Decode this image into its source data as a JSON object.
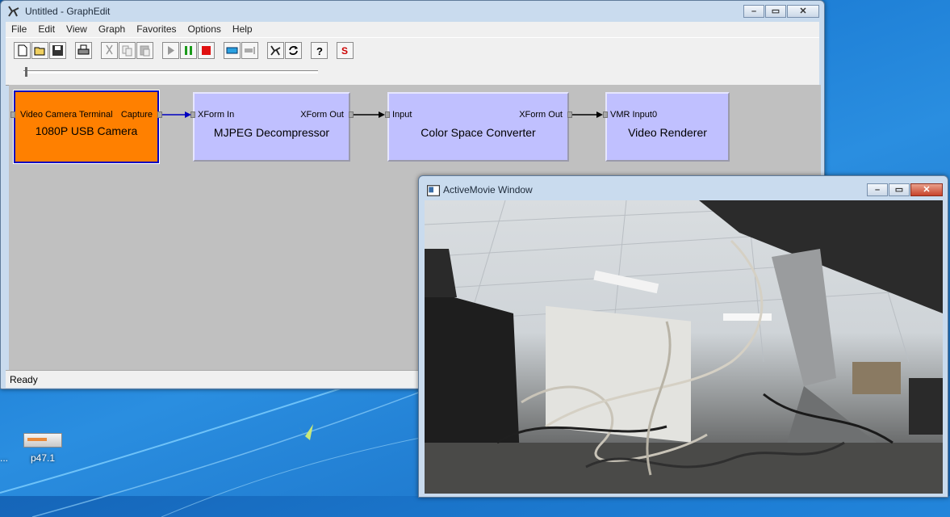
{
  "graphedit": {
    "title": "Untitled - GraphEdit",
    "menus": [
      "File",
      "Edit",
      "View",
      "Graph",
      "Favorites",
      "Options",
      "Help"
    ],
    "toolbar": [
      "new-icon",
      "open-icon",
      "save-icon",
      "print-icon",
      "cut-icon",
      "copy-icon",
      "paste-icon",
      "play-icon",
      "pause-icon",
      "stop-icon",
      "seek-icon",
      "frame-step-icon",
      "filter-graph-icon",
      "refresh-icon",
      "help-icon",
      "sync-icon"
    ],
    "status": "Ready",
    "filters": [
      {
        "name": "1080P USB Camera",
        "pin_in": "Video Camera Terminal",
        "pin_out": "Capture",
        "selected": true
      },
      {
        "name": "MJPEG Decompressor",
        "pin_in": "XForm In",
        "pin_out": "XForm Out"
      },
      {
        "name": "Color Space Converter",
        "pin_in": "Input",
        "pin_out": "XForm Out"
      },
      {
        "name": "Video Renderer",
        "pin_in": "VMR Input0",
        "pin_out": ""
      }
    ]
  },
  "activemovie": {
    "title": "ActiveMovie Window"
  },
  "desktop": {
    "icon_label": "p47.1",
    "partial_label": "..."
  },
  "colors": {
    "selected_filter": "#ff8000",
    "filter": "#c0c0ff",
    "canvas": "#c0c0c0"
  }
}
